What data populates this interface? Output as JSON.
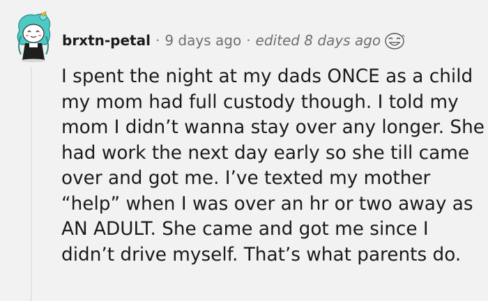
{
  "comment": {
    "author": {
      "username": "brxtn-petal",
      "avatar_icon": "snoo-avatar-icon"
    },
    "timestamp": "9 days ago",
    "separator": "·",
    "edited": "edited 8 days ago",
    "award_icon": "laughing-face-award-icon",
    "body_lines": [
      "I spent the night at my dads ONCE as a child",
      "my mom had full custody though. I told my",
      "mom I didn’t wanna stay over any longer. She",
      "had work the next day early so she till came",
      "over and got me. I’ve texted my mother",
      "“help” when I was over an hr or two away as",
      "AN ADULT. She came and got me since I",
      "didn’t drive myself. That’s what parents do."
    ]
  },
  "colors": {
    "background": "#f2f2f2",
    "text": "#1a1a1a",
    "meta_text": "#6e6e6e",
    "thread_line": "#e3e3e3",
    "avatar_accent": "#4ec9c4"
  }
}
